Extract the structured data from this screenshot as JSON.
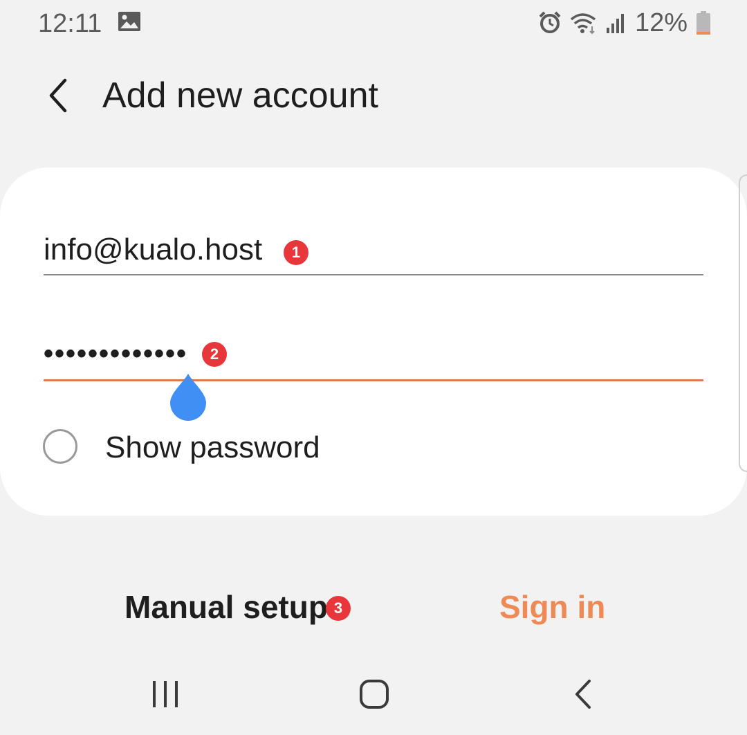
{
  "status_bar": {
    "time": "12:11",
    "battery_percent": "12%",
    "icons": [
      "image-icon",
      "alarm-icon",
      "wifi-icon",
      "signal-icon",
      "battery-icon"
    ],
    "battery_level": 0.12
  },
  "header": {
    "back_icon": "chevron-left-icon",
    "title": "Add new account"
  },
  "form": {
    "email_value": "info@kualo.host",
    "email_badge": "1",
    "password_value": "•••••••••••••",
    "password_badge": "2",
    "show_password_label": "Show password",
    "show_password_checked": false
  },
  "actions": {
    "manual_setup_label": "Manual setup",
    "manual_setup_badge": "3",
    "sign_in_label": "Sign in"
  },
  "nav_bar": {
    "icons": [
      "recent-apps-icon",
      "home-icon",
      "back-icon"
    ]
  },
  "colors": {
    "accent": "#ee8a55",
    "underline_active": "#e07b4f",
    "badge": "#e8373b",
    "cursor_handle": "#3f8ff5",
    "background": "#f2f2f2",
    "card": "#ffffff"
  }
}
